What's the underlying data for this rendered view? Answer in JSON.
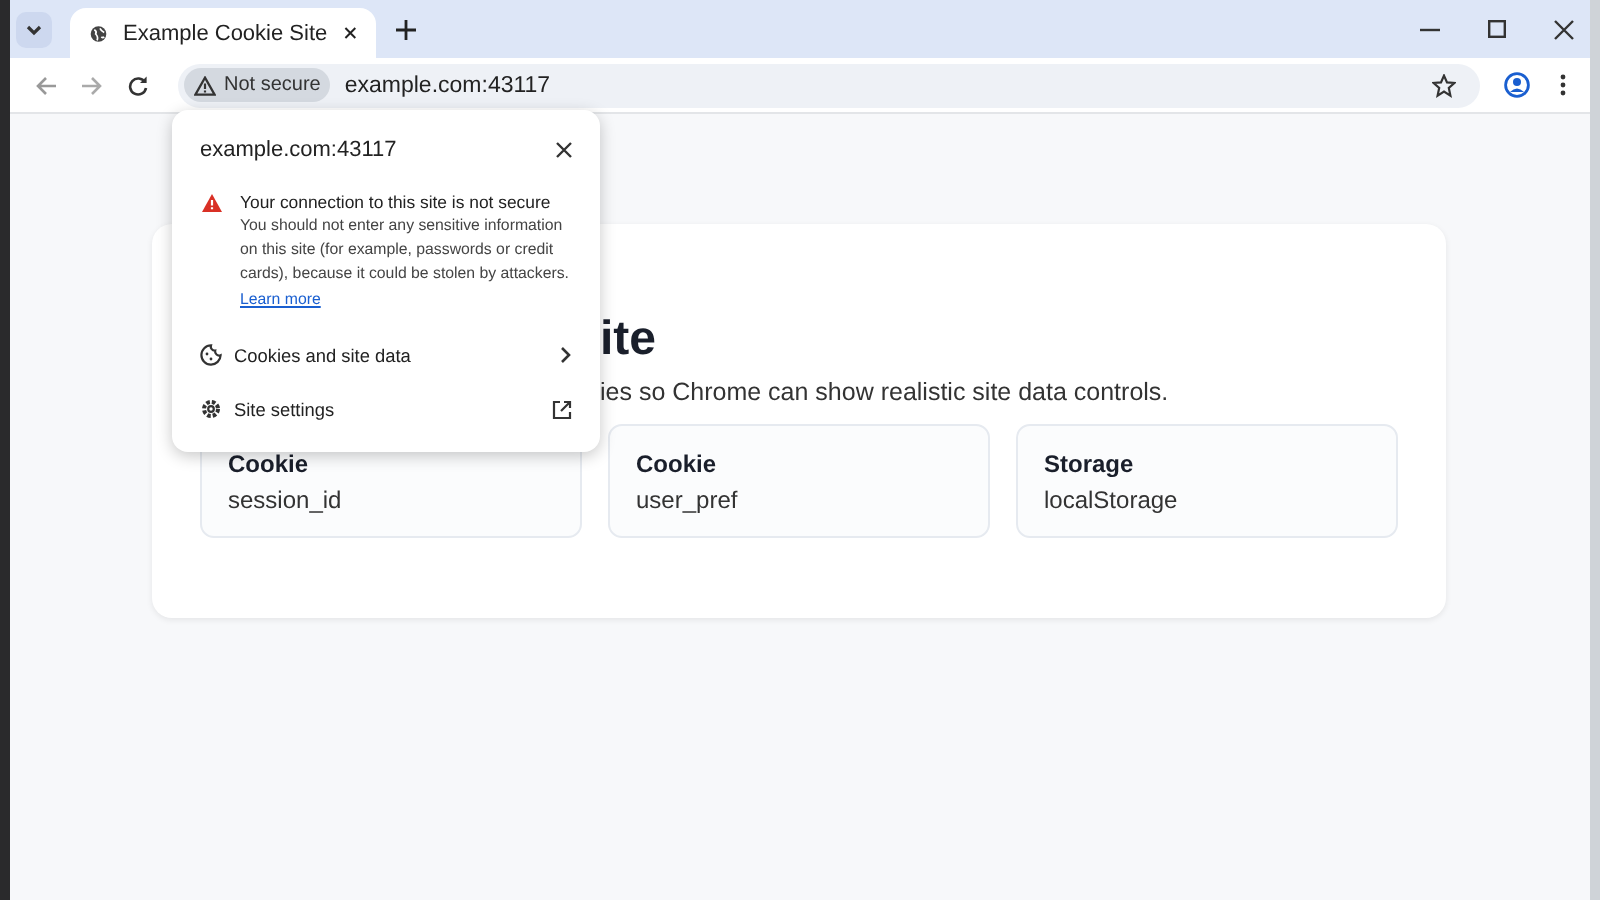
{
  "tab": {
    "title": "Example Cookie Site",
    "selected": true
  },
  "address_bar": {
    "security_chip": "Not secure",
    "url": "example.com:43117"
  },
  "page": {
    "heading": "ite",
    "subtitle": "ies so Chrome can show realistic site data controls.",
    "cards": [
      {
        "type": "Cookie",
        "name": "session_id"
      },
      {
        "type": "Cookie",
        "name": "user_pref"
      },
      {
        "type": "Storage",
        "name": "localStorage"
      }
    ]
  },
  "popup": {
    "title": "example.com:43117",
    "warning_title": "Your connection to this site is not secure",
    "warning_body": "You should not enter any sensitive information on this site (for example, passwords or credit cards), because it could be stolen by attackers.",
    "learn_more": "Learn more",
    "items": [
      {
        "kind": "cookies",
        "label": "Cookies and site data"
      },
      {
        "kind": "settings",
        "label": "Site settings"
      }
    ]
  }
}
